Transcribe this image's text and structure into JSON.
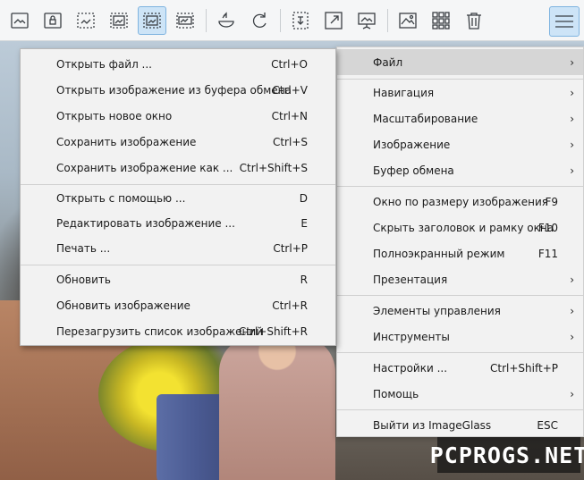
{
  "toolbar": {
    "buttons": [
      {
        "icon": "view-fit-icon"
      },
      {
        "icon": "lock-zoom-icon"
      },
      {
        "icon": "auto-zoom-icon"
      },
      {
        "icon": "scale-to-width-icon"
      },
      {
        "icon": "scale-to-height-icon",
        "active": true
      },
      {
        "icon": "scale-to-fill-icon"
      },
      {
        "icon": "rotate-left-icon"
      },
      {
        "icon": "rotate-right-icon"
      },
      {
        "icon": "checkerboard-icon"
      },
      {
        "icon": "fullscreen-icon"
      },
      {
        "icon": "slideshow-icon"
      },
      {
        "icon": "thumbnail-icon"
      },
      {
        "icon": "gallery-icon"
      },
      {
        "icon": "delete-icon"
      },
      {
        "icon": "hamburger-menu-icon",
        "active": true
      }
    ]
  },
  "main_menu": {
    "items": [
      {
        "label": "Файл",
        "shortcut": "",
        "submenu": true,
        "highlight": true
      },
      {
        "label": "Навигация",
        "shortcut": "",
        "submenu": true
      },
      {
        "label": "Масштабирование",
        "shortcut": "",
        "submenu": true
      },
      {
        "label": "Изображение",
        "shortcut": "",
        "submenu": true
      },
      {
        "label": "Буфер обмена",
        "shortcut": "",
        "submenu": true
      },
      {
        "label": "Окно по размеру изображения",
        "shortcut": "F9",
        "submenu": false
      },
      {
        "label": "Скрыть заголовок и рамку окна",
        "shortcut": "F10",
        "submenu": false
      },
      {
        "label": "Полноэкранный режим",
        "shortcut": "F11",
        "submenu": false
      },
      {
        "label": "Презентация",
        "shortcut": "",
        "submenu": true
      },
      {
        "label": "Элементы управления",
        "shortcut": "",
        "submenu": true
      },
      {
        "label": "Инструменты",
        "shortcut": "",
        "submenu": true
      },
      {
        "label": "Настройки ...",
        "shortcut": "Ctrl+Shift+P",
        "submenu": false
      },
      {
        "label": "Помощь",
        "shortcut": "",
        "submenu": true
      },
      {
        "label": "Выйти из ImageGlass",
        "shortcut": "ESC",
        "submenu": false
      }
    ]
  },
  "file_menu": {
    "items": [
      {
        "label": "Открыть файл ...",
        "shortcut": "Ctrl+O"
      },
      {
        "label": "Открыть изображение из буфера обмена",
        "shortcut": "Ctrl+V"
      },
      {
        "label": "Открыть новое окно",
        "shortcut": "Ctrl+N"
      },
      {
        "label": "Сохранить изображение",
        "shortcut": "Ctrl+S"
      },
      {
        "label": "Сохранить изображение как ...",
        "shortcut": "Ctrl+Shift+S"
      },
      {
        "label": "Открыть с помощью ...",
        "shortcut": "D"
      },
      {
        "label": "Редактировать изображение ...",
        "shortcut": "E"
      },
      {
        "label": "Печать ...",
        "shortcut": "Ctrl+P"
      },
      {
        "label": "Обновить",
        "shortcut": "R"
      },
      {
        "label": "Обновить изображение",
        "shortcut": "Ctrl+R"
      },
      {
        "label": "Перезагрузить список изображений",
        "shortcut": "Ctrl+Shift+R"
      }
    ]
  },
  "arrow_glyph": "›",
  "watermark": "PCPROGS.NET"
}
